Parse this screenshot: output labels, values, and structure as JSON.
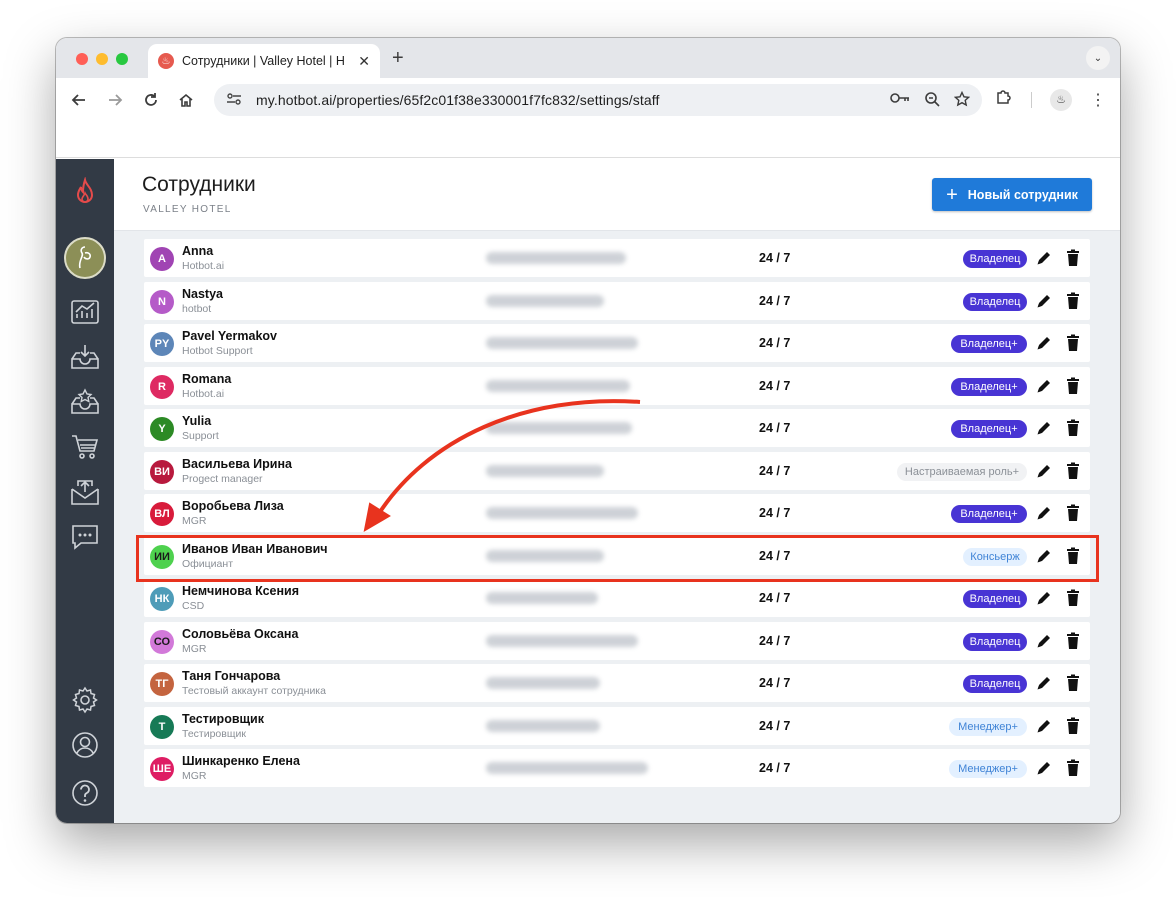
{
  "browser": {
    "tab_title": "Сотрудники | Valley Hotel | H",
    "url": "my.hotbot.ai/properties/65f2c01f38e330001f7fc832/settings/staff"
  },
  "page": {
    "title": "Сотрудники",
    "subtitle": "VALLEY HOTEL",
    "new_button_label": "Новый сотрудник"
  },
  "staff": [
    {
      "initials": "A",
      "name": "Anna",
      "sub": "Hotbot.ai",
      "hours": "24 / 7",
      "role": "Владелец",
      "role_style": "owner",
      "color": "#a044b3"
    },
    {
      "initials": "N",
      "name": "Nastya",
      "sub": "hotbot",
      "hours": "24 / 7",
      "role": "Владелец",
      "role_style": "owner",
      "color": "#b55bc8"
    },
    {
      "initials": "PY",
      "name": "Pavel Yermakov",
      "sub": "Hotbot Support",
      "hours": "24 / 7",
      "role": "Владелец+",
      "role_style": "owner",
      "color": "#5d86b8"
    },
    {
      "initials": "R",
      "name": "Romana",
      "sub": "Hotbot.ai",
      "hours": "24 / 7",
      "role": "Владелец+",
      "role_style": "owner",
      "color": "#de2a62"
    },
    {
      "initials": "Y",
      "name": "Yulia",
      "sub": "Support",
      "hours": "24 / 7",
      "role": "Владелец+",
      "role_style": "owner",
      "color": "#2c8a25"
    },
    {
      "initials": "ВИ",
      "name": "Васильева Ирина",
      "sub": "Progect manager",
      "hours": "24 / 7",
      "role": "Настраиваемая роль+",
      "role_style": "custom",
      "color": "#b8193d"
    },
    {
      "initials": "ВЛ",
      "name": "Воробьева Лиза",
      "sub": "MGR",
      "hours": "24 / 7",
      "role": "Владелец+",
      "role_style": "owner",
      "color": "#d81b3b"
    },
    {
      "initials": "ИИ",
      "name": "Иванов Иван Иванович",
      "sub": "Официант",
      "hours": "24 / 7",
      "role": "Консьерж",
      "role_style": "light",
      "color": "#4ed14e"
    },
    {
      "initials": "НК",
      "name": "Немчинова Ксения",
      "sub": "CSD",
      "hours": "24 / 7",
      "role": "Владелец",
      "role_style": "owner",
      "color": "#4e9cb8"
    },
    {
      "initials": "СО",
      "name": "Соловьёва Оксана",
      "sub": "MGR",
      "hours": "24 / 7",
      "role": "Владелец",
      "role_style": "owner",
      "color": "#d279d9"
    },
    {
      "initials": "ТГ",
      "name": "Таня Гончарова",
      "sub": "Тестовый аккаунт сотрудника",
      "hours": "24 / 7",
      "role": "Владелец",
      "role_style": "owner",
      "color": "#c4643f"
    },
    {
      "initials": "Т",
      "name": "Тестировщик",
      "sub": "Тестировщик",
      "hours": "24 / 7",
      "role": "Менеджер+",
      "role_style": "light",
      "color": "#177a56"
    },
    {
      "initials": "ШЕ",
      "name": "Шинкаренко Елена",
      "sub": "MGR",
      "hours": "24 / 7",
      "role": "Менеджер+",
      "role_style": "light",
      "color": "#de1d63"
    }
  ],
  "colors": {
    "sidebar": "#323a45",
    "accent": "#1f7ad9",
    "owner_badge": "#4834d4",
    "annotation": "#e8331e"
  }
}
